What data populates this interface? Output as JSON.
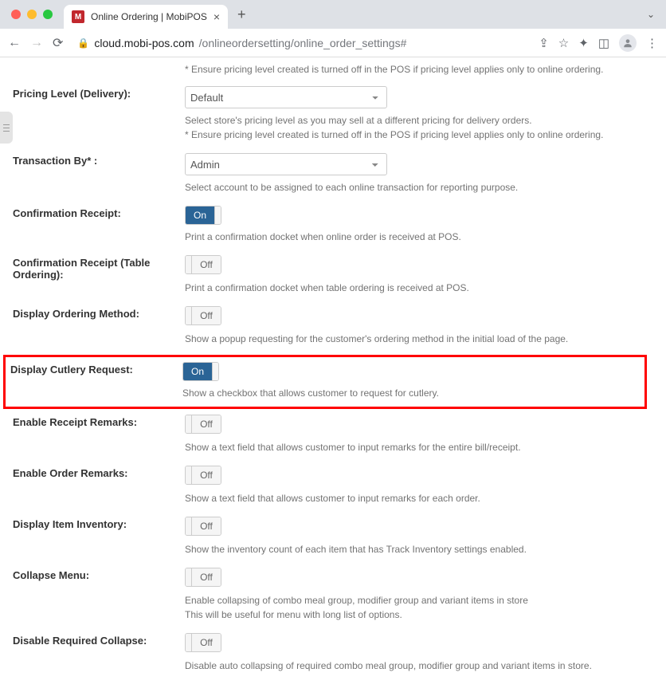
{
  "browser": {
    "tab_title": "Online Ordering | MobiPOS",
    "url_host": "cloud.mobi-pos.com",
    "url_path": "/onlineordersetting/online_order_settings#"
  },
  "top_helper": "* Ensure pricing level created is turned off in the POS if pricing level applies only to online ordering.",
  "settings": {
    "pricing_delivery": {
      "label": "Pricing Level (Delivery):",
      "value": "Default",
      "helper1": "Select store's pricing level as you may sell at a different pricing for delivery orders.",
      "helper2": "* Ensure pricing level created is turned off in the POS if pricing level applies only to online ordering."
    },
    "transaction_by": {
      "label": "Transaction By* :",
      "value": "Admin",
      "helper": "Select account to be assigned to each online transaction for reporting purpose."
    },
    "confirmation_receipt": {
      "label": "Confirmation Receipt:",
      "state": "On",
      "helper": "Print a confirmation docket when online order is received at POS."
    },
    "confirmation_receipt_table": {
      "label": "Confirmation Receipt (Table Ordering):",
      "state": "Off",
      "helper": "Print a confirmation docket when table ordering is received at POS."
    },
    "display_ordering_method": {
      "label": "Display Ordering Method:",
      "state": "Off",
      "helper": "Show a popup requesting for the customer's ordering method in the initial load of the page."
    },
    "display_cutlery": {
      "label": "Display Cutlery Request:",
      "state": "On",
      "helper": "Show a checkbox that allows customer to request for cutlery."
    },
    "enable_receipt_remarks": {
      "label": "Enable Receipt Remarks:",
      "state": "Off",
      "helper": "Show a text field that allows customer to input remarks for the entire bill/receipt."
    },
    "enable_order_remarks": {
      "label": "Enable Order Remarks:",
      "state": "Off",
      "helper": "Show a text field that allows customer to input remarks for each order."
    },
    "display_item_inventory": {
      "label": "Display Item Inventory:",
      "state": "Off",
      "helper": "Show the inventory count of each item that has Track Inventory settings enabled."
    },
    "collapse_menu": {
      "label": "Collapse Menu:",
      "state": "Off",
      "helper1": "Enable collapsing of combo meal group, modifier group and variant items in store",
      "helper2": "This will be useful for menu with long list of options."
    },
    "disable_required_collapse": {
      "label": "Disable Required Collapse:",
      "state": "Off",
      "helper": "Disable auto collapsing of required combo meal group, modifier group and variant items in store."
    }
  },
  "toggle_labels": {
    "on": "On",
    "off": "Off"
  }
}
